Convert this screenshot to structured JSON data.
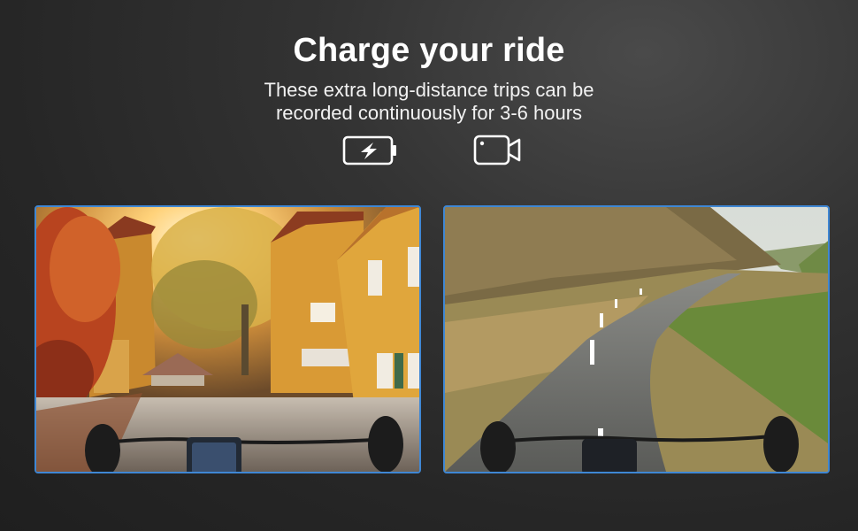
{
  "header": {
    "title": "Charge your ride",
    "subtitle_line1": "These extra long-distance trips can be",
    "subtitle_line2": "recorded continuously for 3-6 hours"
  },
  "icons": [
    {
      "name": "battery-charging-icon"
    },
    {
      "name": "video-camera-icon"
    }
  ],
  "photos": [
    {
      "name": "village-street-photo"
    },
    {
      "name": "mountain-road-photo"
    }
  ],
  "colors": {
    "frame_border": "#3f87d4",
    "background": "#2b2b2b",
    "text": "#ffffff"
  }
}
